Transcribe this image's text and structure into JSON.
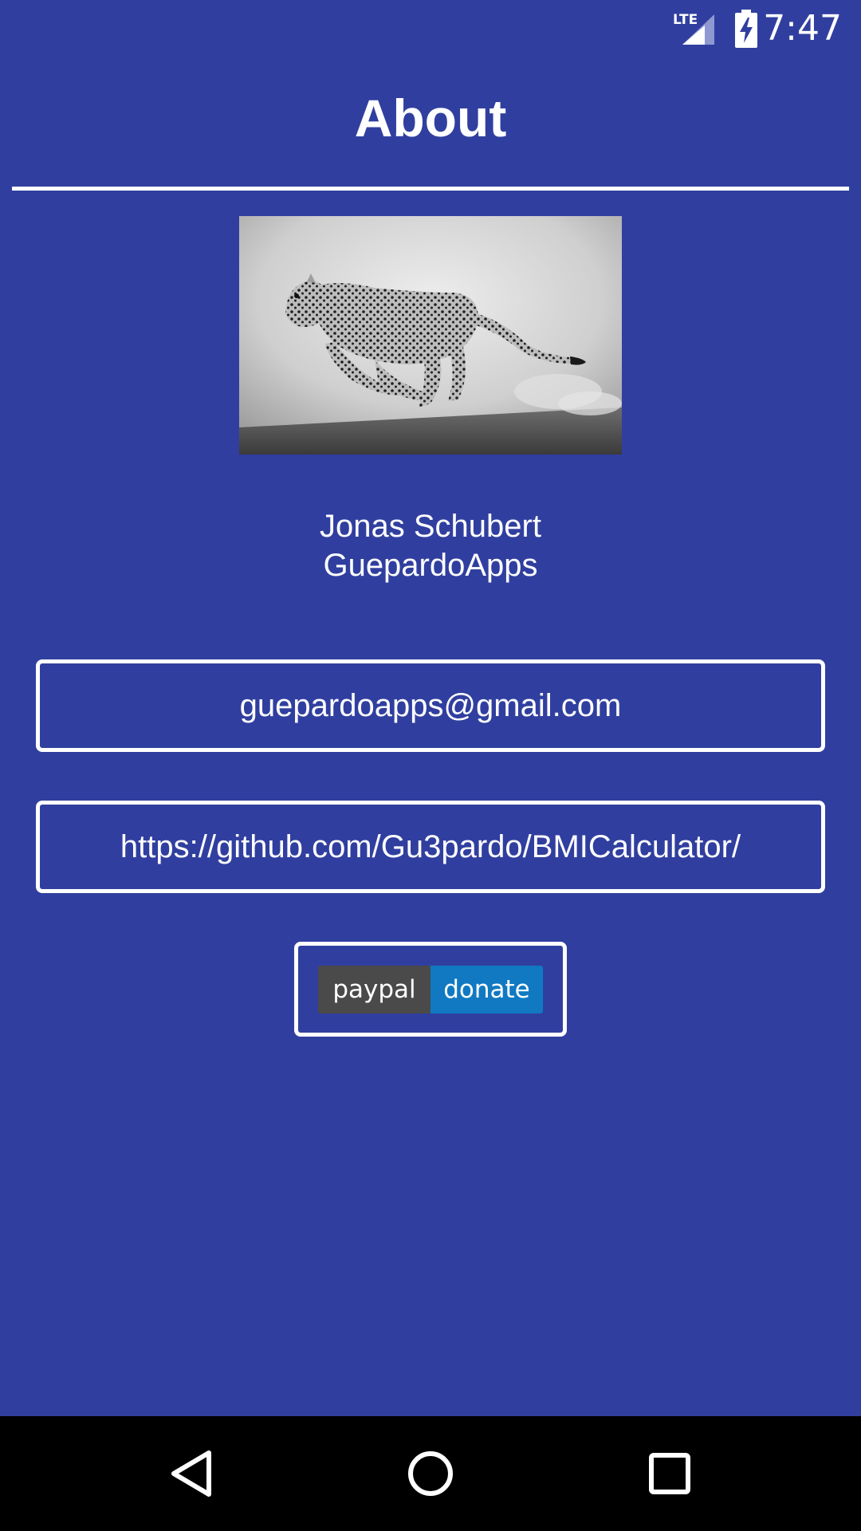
{
  "status_bar": {
    "network_label": "LTE",
    "time": "7:47"
  },
  "header": {
    "title": "About"
  },
  "author": {
    "name": "Jonas Schubert",
    "company": "GuepardoApps"
  },
  "links": {
    "email": "guepardoapps@gmail.com",
    "github": "https://github.com/Gu3pardo/BMICalculator/"
  },
  "donate": {
    "left_label": "paypal",
    "right_label": "donate"
  },
  "icons": {
    "signal": "lte-signal-icon",
    "battery": "battery-charging-icon",
    "back": "back-icon",
    "home": "home-icon",
    "recents": "recents-icon"
  },
  "colors": {
    "background": "#303f9f",
    "paypal_gray": "#4a4a4a",
    "paypal_blue": "#1079c2"
  }
}
